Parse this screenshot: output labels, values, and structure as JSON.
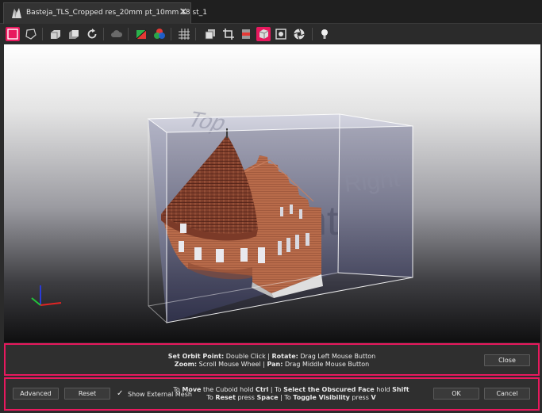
{
  "tab": {
    "title": "Basteja_TLS_Cropped res_20mm pt_10mm 18 st_1",
    "close_glyph": "✕"
  },
  "toolbar": {
    "icons": [
      "rect-select-icon",
      "lasso-select-icon",
      "crop-inside-icon",
      "crop-outside-icon",
      "rotate-icon",
      "cloud-icon",
      "color-clear-icon",
      "rgb-color-icon",
      "grid-icon",
      "view-box-icon",
      "crop-tool-icon",
      "layer-stack-icon",
      "cuboid-icon",
      "camera-fit-icon",
      "aperture-icon",
      "lightbulb-icon"
    ],
    "active_color": "#e8195e"
  },
  "viewport": {
    "face_labels": {
      "top": "Top",
      "right": "Right",
      "front": "Front"
    },
    "background_top": "#ffffff",
    "background_bottom": "#0f0f10"
  },
  "hint_panel": {
    "line1": {
      "a": "Set Orbit Point:",
      "b": " Double Click | ",
      "c": "Rotate:",
      "d": " Drag Left Mouse Button"
    },
    "line2": {
      "a": "Zoom:",
      "b": " Scroll Mouse Wheel | ",
      "c": "Pan:",
      "d": " Drag Middle Mouse Button"
    },
    "close_label": "Close"
  },
  "action_panel": {
    "advanced_label": "Advanced",
    "reset_label": "Reset",
    "show_mesh_label": "Show External Mesh",
    "show_mesh_checked": true,
    "check_glyph": "✓",
    "line1": {
      "a": "To ",
      "b": "Move",
      "c": " the Cuboid hold ",
      "d": "Ctrl",
      "e": " | To ",
      "f": "Select the Obscured Face",
      "g": " hold ",
      "h": "Shift"
    },
    "line2": {
      "a": "To ",
      "b": "Reset",
      "c": " press ",
      "d": "Space",
      "e": " | To ",
      "f": "Toggle Visibility",
      "g": " press ",
      "h": "V"
    },
    "ok_label": "OK",
    "cancel_label": "Cancel"
  },
  "colors": {
    "accent": "#e8195e",
    "panel_bg": "#2f2f2f",
    "text": "#e8e8e8"
  }
}
